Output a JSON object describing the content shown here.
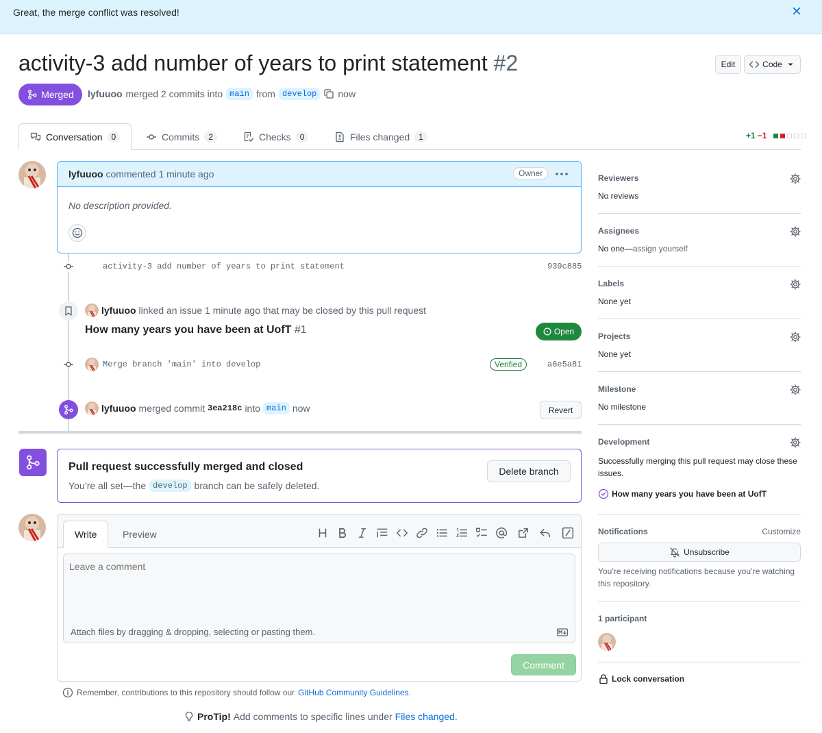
{
  "flash": {
    "message": "Great, the merge conflict was resolved!"
  },
  "header": {
    "title": "activity-3 add number of years to print statement",
    "number": "#2",
    "edit_label": "Edit",
    "code_label": "Code"
  },
  "state": {
    "label": "Merged",
    "author": "lyfuuoo",
    "text_merged": "merged 2 commits into",
    "base_branch": "main",
    "text_from": "from",
    "head_branch": "develop",
    "time": "now"
  },
  "tabs": [
    {
      "label": "Conversation",
      "count": "0"
    },
    {
      "label": "Commits",
      "count": "2"
    },
    {
      "label": "Checks",
      "count": "0"
    },
    {
      "label": "Files changed",
      "count": "1"
    }
  ],
  "diffstat": {
    "additions": "+1",
    "deletions": "−1"
  },
  "comment": {
    "author": "lyfuuoo",
    "action": "commented 1 minute ago",
    "badge": "Owner",
    "body": "No description provided."
  },
  "commits": [
    {
      "message": "activity-3 add number of years to print statement",
      "sha": "939c885"
    },
    {
      "message": "Merge branch 'main' into develop",
      "sha": "a6e5a81",
      "badge": "Verified"
    }
  ],
  "linked_issue": {
    "author": "lyfuuoo",
    "text": "linked an issue 1 minute ago that may be closed by this pull request",
    "title": "How many years you have been at UofT",
    "number": "#1",
    "status": "Open"
  },
  "merge_event": {
    "author": "lyfuuoo",
    "text_merged": "merged commit",
    "sha": "3ea218c",
    "text_into": "into",
    "branch": "main",
    "time": "now",
    "revert_label": "Revert"
  },
  "merged_box": {
    "title": "Pull request successfully merged and closed",
    "sub_prefix": "You’re all set—the",
    "branch": "develop",
    "sub_suffix": "branch can be safely deleted.",
    "delete_label": "Delete branch"
  },
  "write": {
    "tab_write": "Write",
    "tab_preview": "Preview",
    "placeholder": "Leave a comment",
    "attach_text": "Attach files by dragging & dropping, selecting or pasting them.",
    "comment_label": "Comment"
  },
  "footer": {
    "remember_prefix": "Remember, contributions to this repository should follow our",
    "remember_link": "GitHub Community Guidelines",
    "remember_suffix": ".",
    "protip_label": "ProTip!",
    "protip_text": "Add comments to specific lines under",
    "protip_link": "Files changed",
    "protip_suffix": "."
  },
  "sidebar": {
    "reviewers": {
      "title": "Reviewers",
      "value": "No reviews"
    },
    "assignees": {
      "title": "Assignees",
      "value": "No one—",
      "link": "assign yourself"
    },
    "labels": {
      "title": "Labels",
      "value": "None yet"
    },
    "projects": {
      "title": "Projects",
      "value": "None yet"
    },
    "milestone": {
      "title": "Milestone",
      "value": "No milestone"
    },
    "development": {
      "title": "Development",
      "value": "Successfully merging this pull request may close these issues.",
      "issue": "How many years you have been at UofT"
    },
    "notifications": {
      "title": "Notifications",
      "customize": "Customize",
      "button": "Unsubscribe",
      "note": "You’re receiving notifications because you’re watching this repository."
    },
    "participants": {
      "title": "1 participant"
    },
    "lock": "Lock conversation"
  },
  "colors": {
    "merged": "#8250df",
    "open": "#1f883d",
    "accent": "#0969da",
    "flash_bg": "#ddf4ff"
  }
}
